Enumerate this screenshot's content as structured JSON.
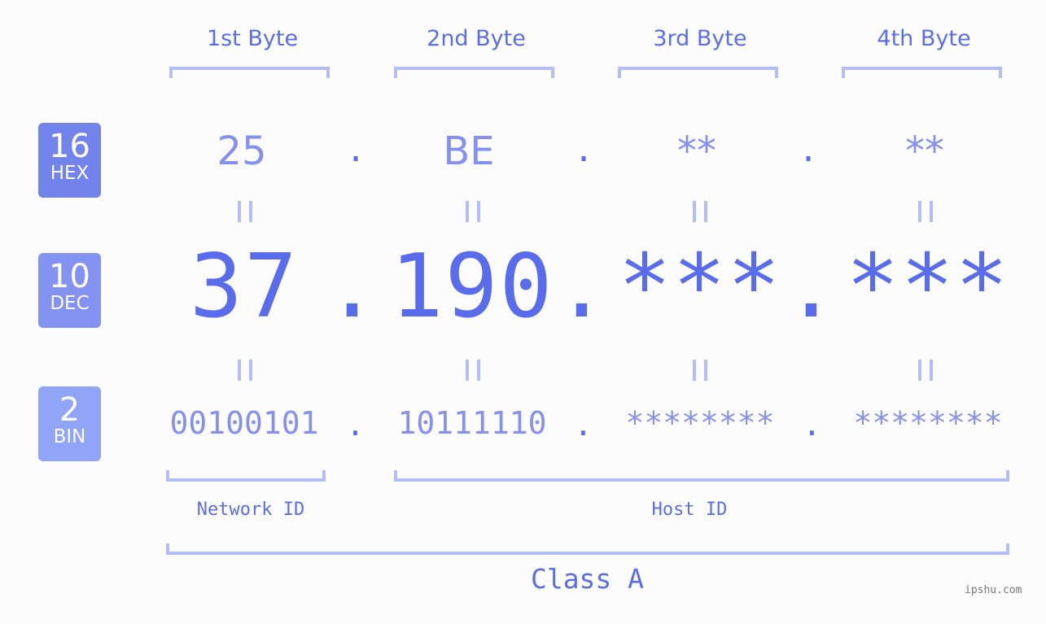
{
  "bytes": [
    {
      "label": "1st Byte",
      "hex": "25",
      "dec": "37",
      "bin": "00100101"
    },
    {
      "label": "2nd Byte",
      "hex": "BE",
      "dec": "190",
      "bin": "10111110"
    },
    {
      "label": "3rd Byte",
      "hex": "**",
      "dec": "***",
      "bin": "********"
    },
    {
      "label": "4th Byte",
      "hex": "**",
      "dec": "***",
      "bin": "********"
    }
  ],
  "separator": ".",
  "bases": {
    "hex": {
      "num": "16",
      "name": "HEX",
      "color": "#7383ec"
    },
    "dec": {
      "num": "10",
      "name": "DEC",
      "color": "#8492f1"
    },
    "bin": {
      "num": "2",
      "name": "BIN",
      "color": "#90a5f8"
    }
  },
  "network_id_label": "Network ID",
  "host_id_label": "Host ID",
  "class_label": "Class A",
  "watermark": "ipshu.com"
}
